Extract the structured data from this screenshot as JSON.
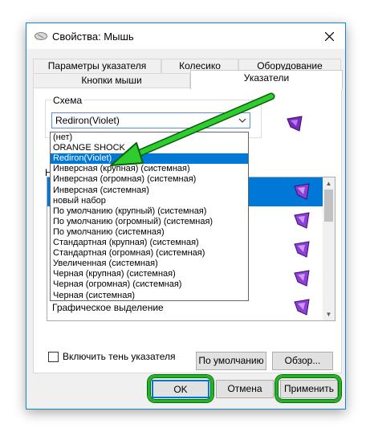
{
  "window": {
    "title": "Свойства: Мышь",
    "close_glyph": "✕"
  },
  "tabs": [
    {
      "label": "Параметры указателя",
      "active": false
    },
    {
      "label": "Колесико",
      "active": false
    },
    {
      "label": "Оборудование",
      "active": false
    },
    {
      "label": "Кнопки мыши",
      "active": false
    },
    {
      "label": "Указатели",
      "active": true
    }
  ],
  "scheme": {
    "group_label": "Схема",
    "selected": "Rediron(Violet)",
    "options": [
      "(нет)",
      "ORANGE SHOCK",
      "Rediron(Violet)",
      "Инверсная (крупная) (системная)",
      "Инверсная (огромная) (системная)",
      "Инверсная (системная)",
      "новый набор",
      "По умолчанию (крупный) (системная)",
      "По умолчанию (огромный) (системная)",
      "По умолчанию (системная)",
      "Стандартная (крупная) (системная)",
      "Стандартная (огромная) (системная)",
      "Увеличенная (системная)",
      "Черная (крупная) (системная)",
      "Черная (огромная) (системная)",
      "Черная (системная)"
    ],
    "highlighted_index": 2
  },
  "settings": {
    "partial_label": "Н",
    "rows": [
      {
        "label": "",
        "icon": "violet-cursor-icon",
        "selected": true
      },
      {
        "label": "",
        "icon": "violet-cursor-icon",
        "selected": false
      },
      {
        "label": "",
        "icon": "violet-cursor-icon",
        "selected": false
      },
      {
        "label": "",
        "icon": "violet-cursor-icon",
        "selected": false
      },
      {
        "label": "Графическое выделение",
        "icon": "violet-cursor-icon",
        "selected": false
      }
    ]
  },
  "shadow": {
    "label": "Включить тень указателя",
    "checked": false
  },
  "buttons": {
    "default": "По умолчанию",
    "browse": "Обзор...",
    "ok": "OK",
    "cancel": "Отмена",
    "apply": "Применить"
  },
  "colors": {
    "accent": "#0078d7",
    "highlight": "#22b522",
    "cursor_violet": "#7b2cbf"
  }
}
